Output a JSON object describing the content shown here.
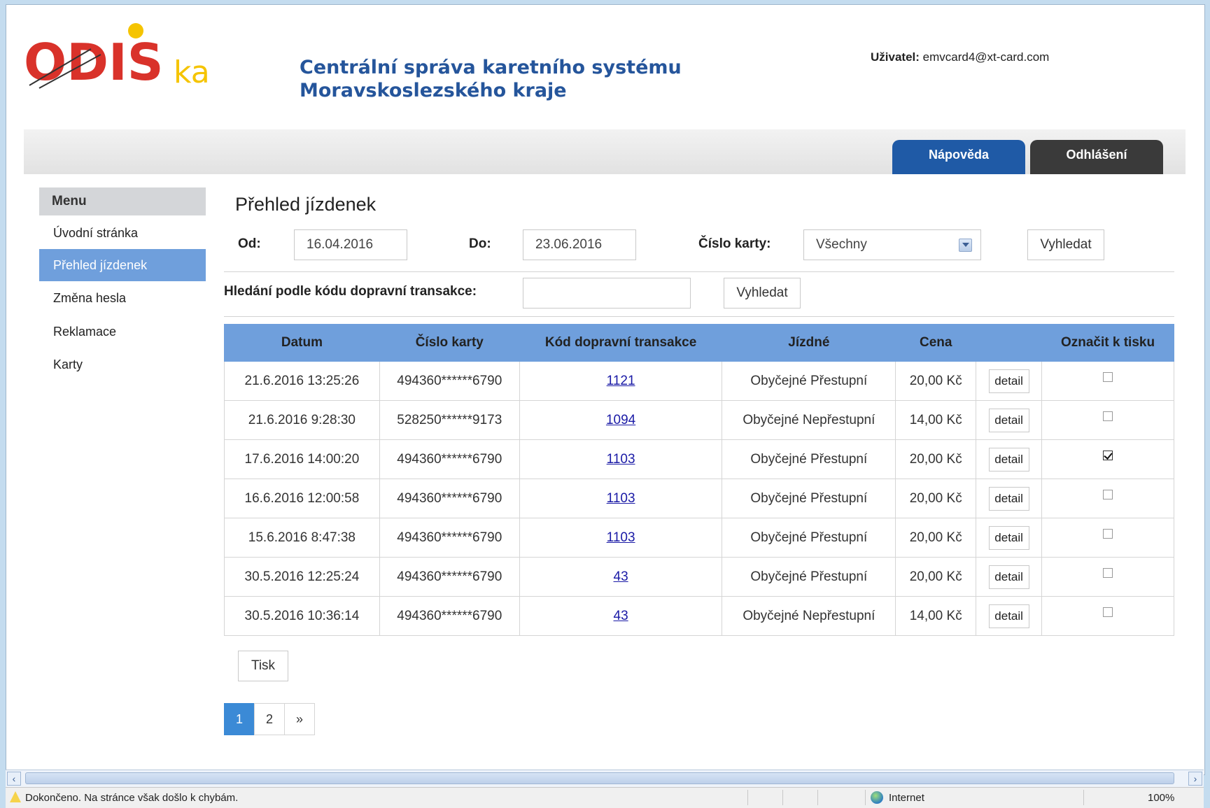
{
  "header": {
    "title_line1": "Centrální správa karetního systému",
    "title_line2": "Moravskoslezského kraje",
    "user_label": "Uživatel:",
    "user_email": "emvcard4@xt-card.com",
    "logo_text_main": "ODIS",
    "logo_text_suffix": "ka"
  },
  "tabs": {
    "help": "Nápověda",
    "logout": "Odhlášení"
  },
  "sidebar": {
    "title": "Menu",
    "items": [
      {
        "label": "Úvodní stránka",
        "active": false
      },
      {
        "label": "Přehled jízdenek",
        "active": true
      },
      {
        "label": "Změna hesla",
        "active": false
      },
      {
        "label": "Reklamace",
        "active": false
      },
      {
        "label": "Karty",
        "active": false
      }
    ]
  },
  "main": {
    "heading": "Přehled jízdenek",
    "from_label": "Od:",
    "from_value": "16.04.2016",
    "to_label": "Do:",
    "to_value": "23.06.2016",
    "card_label": "Číslo karty:",
    "card_value": "Všechny",
    "search_button": "Vyhledat",
    "code_search_label": "Hledání podle kódu dopravní transakce:",
    "code_search_value": "",
    "code_search_button": "Vyhledat"
  },
  "table": {
    "headers": [
      "Datum",
      "Číslo karty",
      "Kód dopravní transakce",
      "Jízdné",
      "Cena",
      "",
      "Označit k tisku"
    ],
    "rows": [
      {
        "date": "21.6.2016 13:25:26",
        "card": "494360******6790",
        "code": "1121",
        "fare": "Obyčejné Přestupní",
        "price": "20,00 Kč",
        "detail": "detail",
        "checked": false
      },
      {
        "date": "21.6.2016 9:28:30",
        "card": "528250******9173",
        "code": "1094",
        "fare": "Obyčejné Nepřestupní",
        "price": "14,00 Kč",
        "detail": "detail",
        "checked": false
      },
      {
        "date": "17.6.2016 14:00:20",
        "card": "494360******6790",
        "code": "1103",
        "fare": "Obyčejné Přestupní",
        "price": "20,00 Kč",
        "detail": "detail",
        "checked": true
      },
      {
        "date": "16.6.2016 12:00:58",
        "card": "494360******6790",
        "code": "1103",
        "fare": "Obyčejné Přestupní",
        "price": "20,00 Kč",
        "detail": "detail",
        "checked": false
      },
      {
        "date": "15.6.2016 8:47:38",
        "card": "494360******6790",
        "code": "1103",
        "fare": "Obyčejné Přestupní",
        "price": "20,00 Kč",
        "detail": "detail",
        "checked": false
      },
      {
        "date": "30.5.2016 12:25:24",
        "card": "494360******6790",
        "code": "43",
        "fare": "Obyčejné Přestupní",
        "price": "20,00 Kč",
        "detail": "detail",
        "checked": false
      },
      {
        "date": "30.5.2016 10:36:14",
        "card": "494360******6790",
        "code": "43",
        "fare": "Obyčejné Nepřestupní",
        "price": "14,00 Kč",
        "detail": "detail",
        "checked": false
      }
    ]
  },
  "print_button": "Tisk",
  "pagination": {
    "pages": [
      "1",
      "2"
    ],
    "next": "»",
    "current": "1"
  },
  "statusbar": {
    "message": "Dokončeno. Na stránce však došlo k chybám.",
    "zone": "Internet",
    "zoom": "100%"
  },
  "colors": {
    "accent_blue": "#6f9fdc",
    "help_tab": "#1f5aa6",
    "logout_tab": "#3a3a3a",
    "title_blue": "#25559b",
    "logo_red": "#d9322a",
    "logo_yellow": "#f5c400"
  }
}
